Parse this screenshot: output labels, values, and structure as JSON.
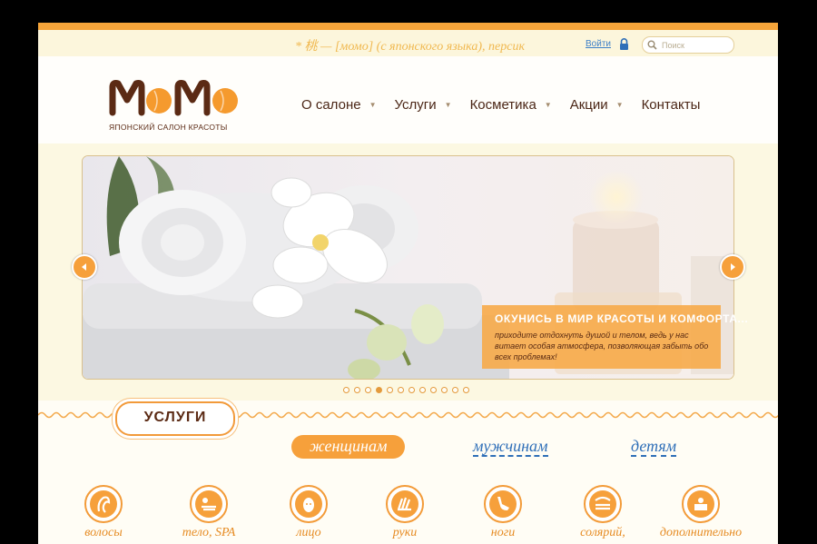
{
  "top": {
    "tagline": "* 桃 — [момо] (с японского языка), персик",
    "login_label": "Войти",
    "search_placeholder": "Поиск"
  },
  "logo": {
    "word": "MOMO",
    "subtitle": "ЯПОНСКИЙ САЛОН КРАСОТЫ"
  },
  "nav": {
    "items": [
      {
        "label": "О салоне"
      },
      {
        "label": "Услуги"
      },
      {
        "label": "Косметика"
      },
      {
        "label": "Акции"
      },
      {
        "label": "Контакты"
      }
    ]
  },
  "slider": {
    "caption_title": "ОКУНИСЬ В МИР КРАСОТЫ И КОМФОРТА...",
    "caption_text": "приходите отдохнуть душой и телом, ведь у нас витает особая атмосфера, позволяющая забыть обо всех проблемах!",
    "slide_count": 12,
    "active_slide": 4
  },
  "services": {
    "heading": "УСЛУГИ",
    "tabs": [
      {
        "label": "женщинам",
        "active": true
      },
      {
        "label": "мужчинам",
        "active": false
      },
      {
        "label": "детям",
        "active": false
      }
    ],
    "categories": [
      {
        "label": "волосы",
        "icon": "hair-icon"
      },
      {
        "label": "тело, SPA",
        "icon": "body-spa-icon"
      },
      {
        "label": "лицо",
        "icon": "face-icon"
      },
      {
        "label": "руки",
        "icon": "hands-icon"
      },
      {
        "label": "ноги",
        "icon": "feet-icon"
      },
      {
        "label": "солярий,",
        "icon": "solarium-icon"
      },
      {
        "label": "дополнительно",
        "icon": "extra-icon"
      }
    ]
  },
  "colors": {
    "accent": "#f6a03b",
    "brand_brown": "#5b2a14",
    "link_blue": "#2f6fb8"
  }
}
